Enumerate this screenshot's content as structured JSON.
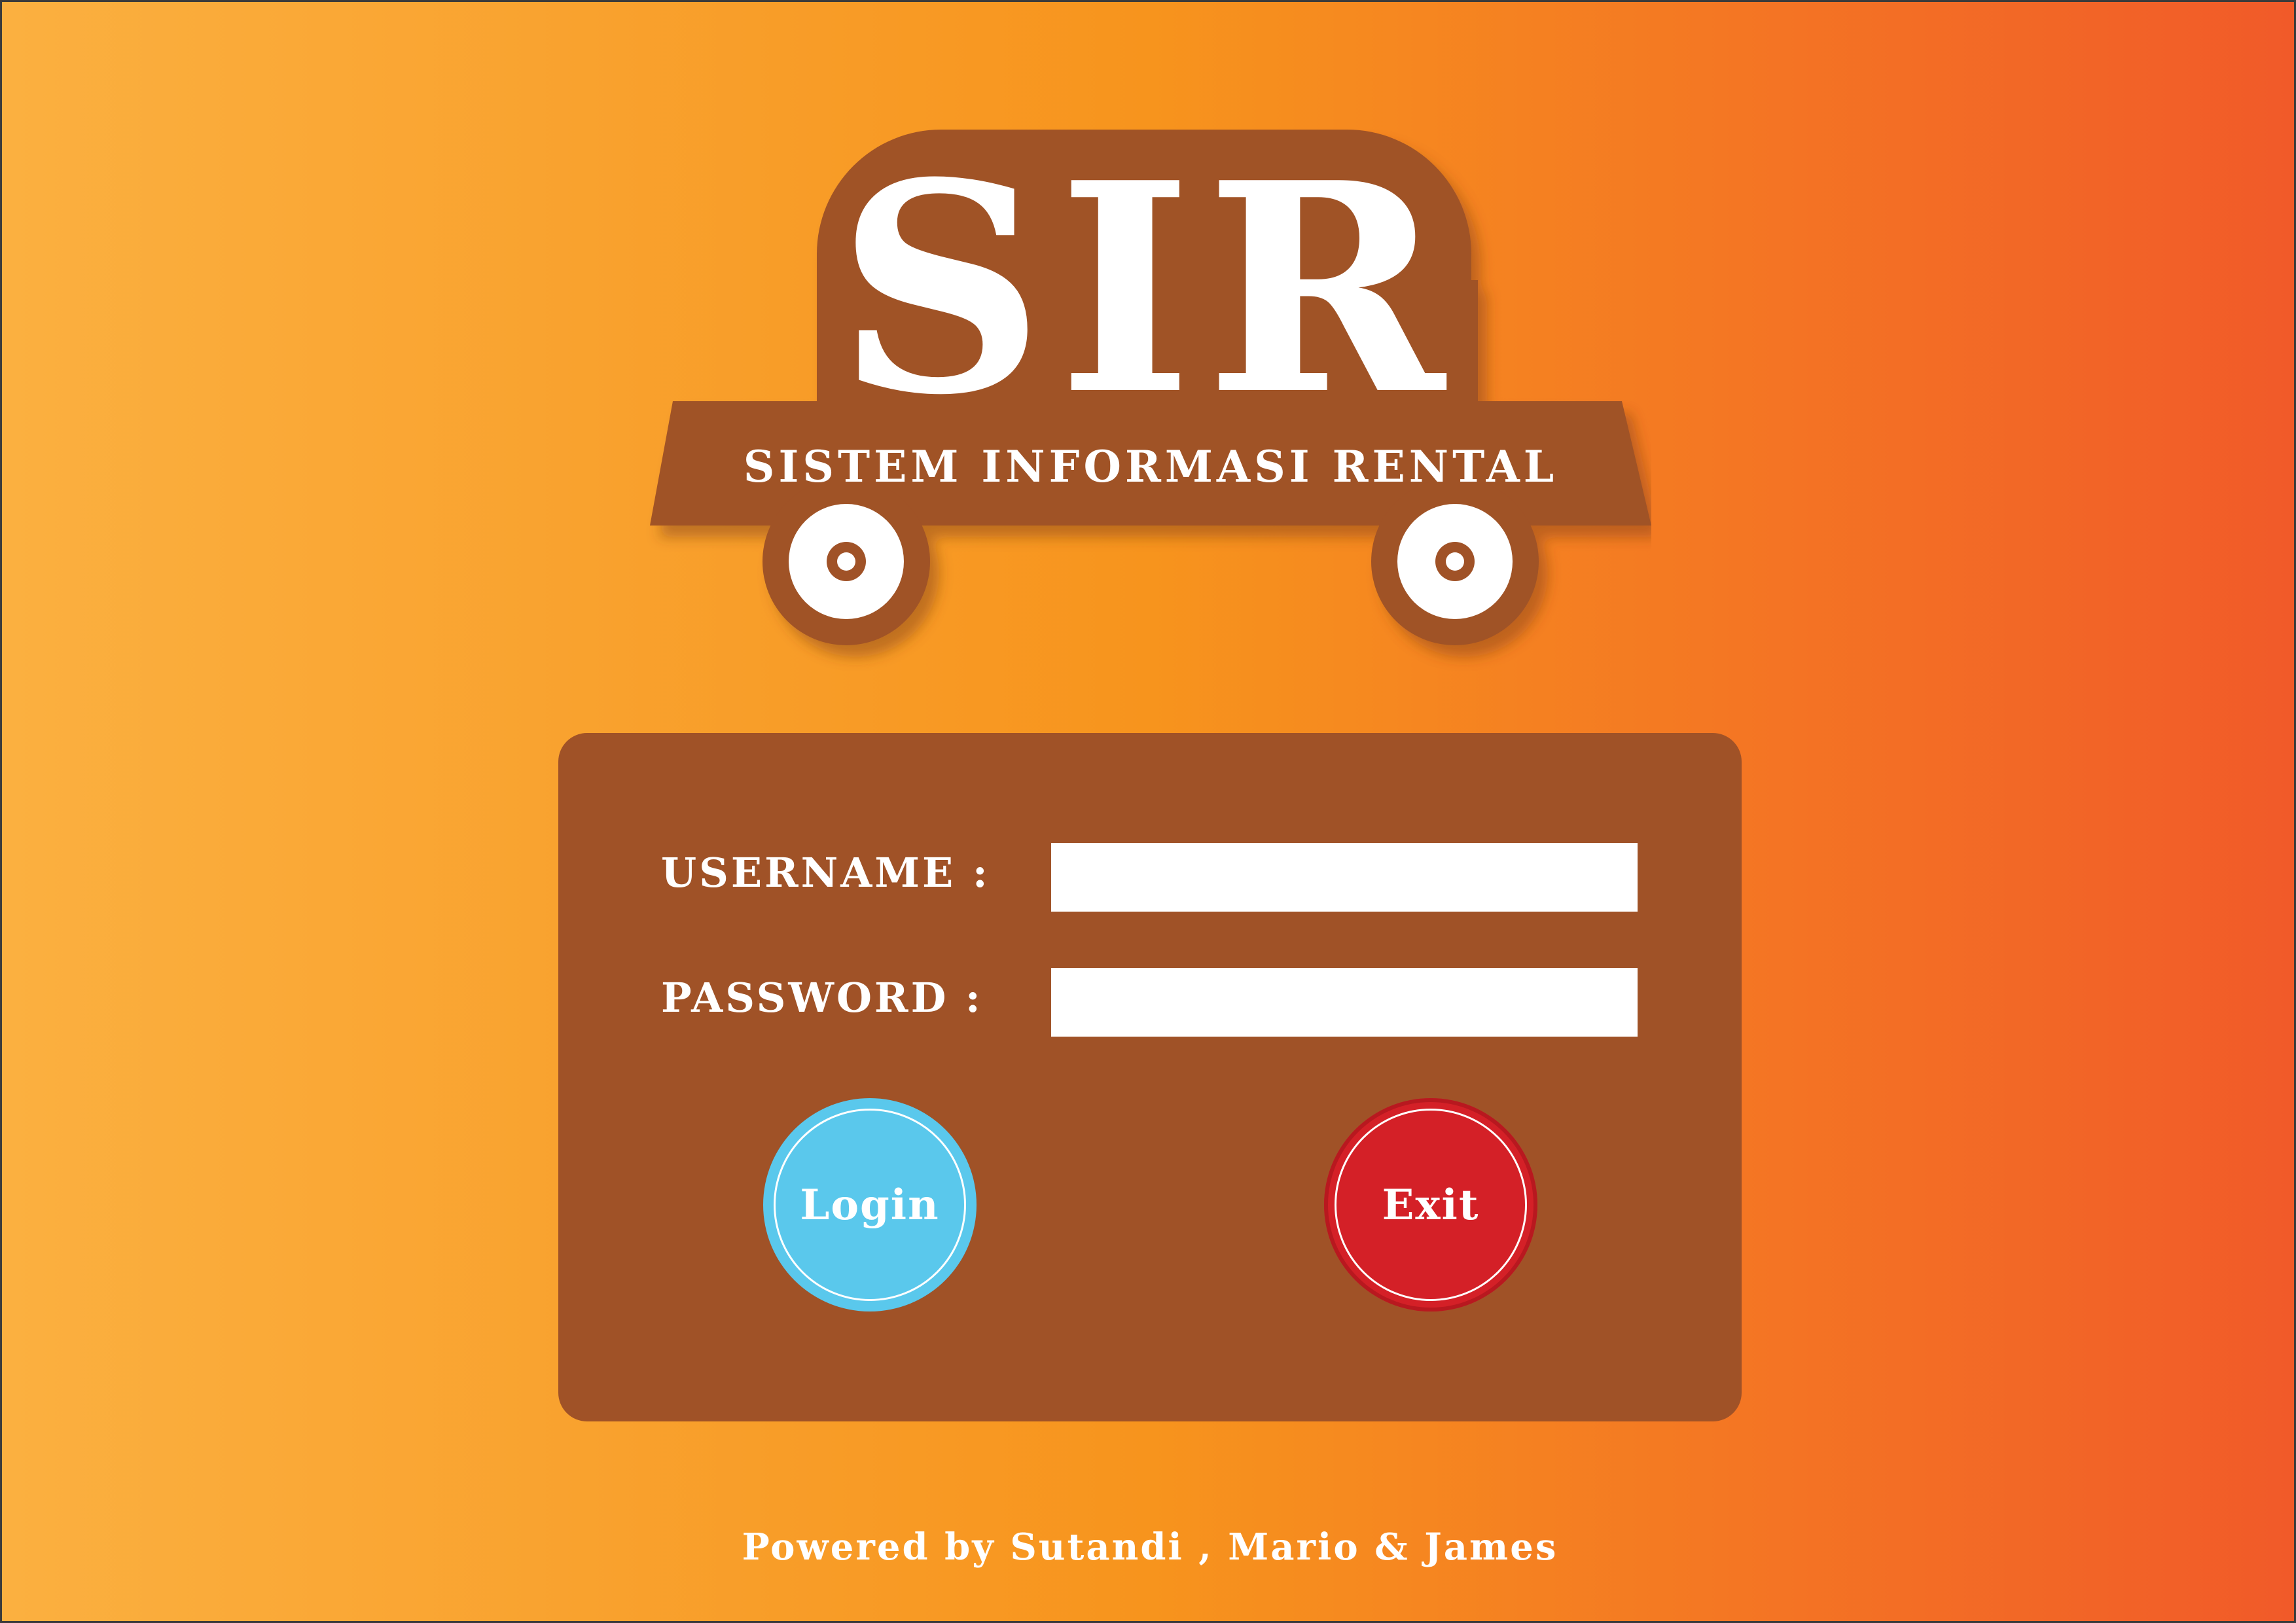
{
  "logo": {
    "title": "SIR",
    "subtitle": "SISTEM INFORMASI RENTAL"
  },
  "login_form": {
    "username_label": "USERNAME :",
    "username_value": "",
    "password_label": "PASSWORD :",
    "password_value": "",
    "login_label": "Login",
    "exit_label": "Exit"
  },
  "footer": {
    "credits": "Powered by Sutandi , Mario & James"
  },
  "colors": {
    "background_start": "#fbb040",
    "background_end": "#f15a29",
    "panel": "#a05227",
    "login_button": "#5ac8ec",
    "exit_button": "#d42027"
  },
  "icons": {
    "logo_graphic": "cart-icon"
  }
}
